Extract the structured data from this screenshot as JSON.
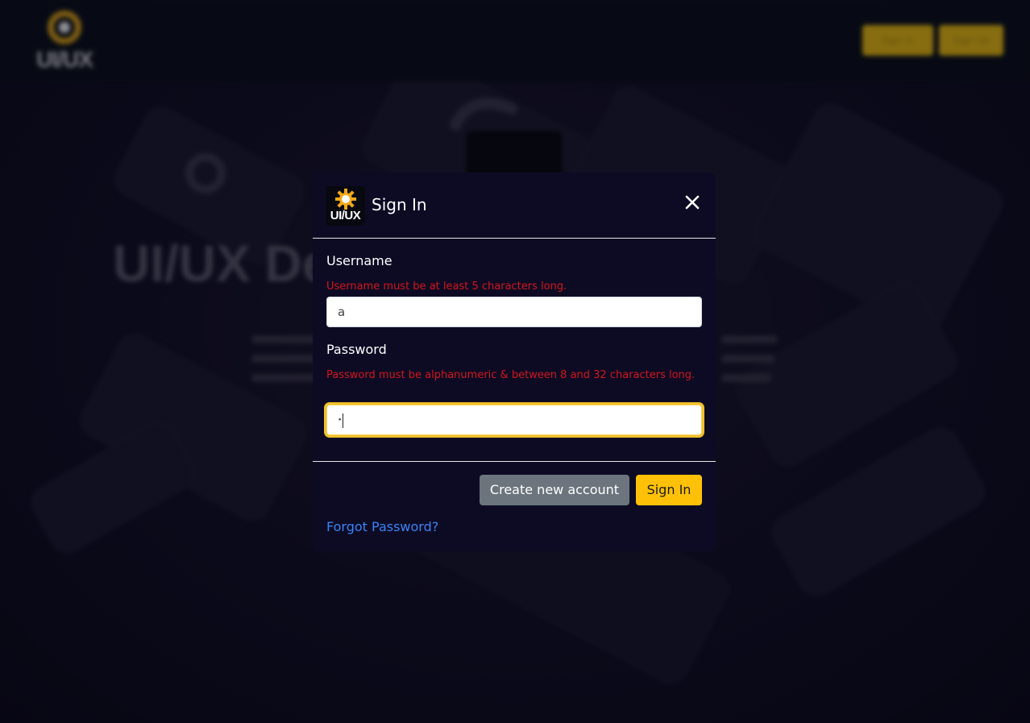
{
  "background": {
    "nav_logo_text": "UI/UX",
    "nav_buttons": [
      "Sign In",
      "Sign Up"
    ],
    "hero_title": "UI/UX Design Learning"
  },
  "modal": {
    "logo_text": "UI/UX",
    "title": "Sign In",
    "close_icon": "close-icon",
    "username": {
      "label": "Username",
      "error": "Username must be at least 5 characters long.",
      "value": "a"
    },
    "password": {
      "label": "Password",
      "error": "Password must be alphanumeric & between 8 and 32 characters long.",
      "value": "•"
    },
    "create_account_label": "Create new account",
    "sign_in_label": "Sign In",
    "forgot_password_label": "Forgot Password?"
  },
  "colors": {
    "accent": "#ffc107",
    "error": "#d4141c",
    "link": "#3b82f6",
    "modal_bg": "#0d0b24",
    "secondary_button": "#6c757d"
  }
}
